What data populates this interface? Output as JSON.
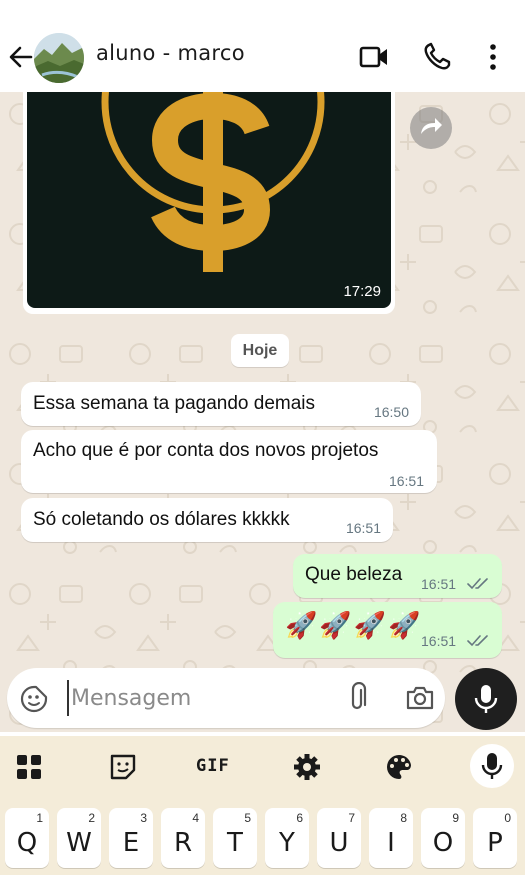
{
  "header": {
    "contact_name": "aluno - marco"
  },
  "chat": {
    "media_time": "17:29",
    "date_chip": "Hoje",
    "messages": [
      {
        "text": "Essa semana ta pagando demais",
        "time": "16:50"
      },
      {
        "text": "Acho que é por conta dos novos projetos",
        "time": "16:51"
      },
      {
        "text": "Só coletando os dólares kkkkk",
        "time": "16:51"
      },
      {
        "text": "Que beleza",
        "time": "16:51"
      },
      {
        "text": "🚀🚀🚀🚀",
        "time": "16:51"
      }
    ]
  },
  "composer": {
    "placeholder": "Mensagem"
  },
  "keyboard": {
    "gif_label": "GIF",
    "keys": [
      {
        "char": "Q",
        "num": "1"
      },
      {
        "char": "W",
        "num": "2"
      },
      {
        "char": "E",
        "num": "3"
      },
      {
        "char": "R",
        "num": "4"
      },
      {
        "char": "T",
        "num": "5"
      },
      {
        "char": "Y",
        "num": "6"
      },
      {
        "char": "U",
        "num": "7"
      },
      {
        "char": "I",
        "num": "8"
      },
      {
        "char": "O",
        "num": "9"
      },
      {
        "char": "P",
        "num": "0"
      }
    ]
  },
  "icons": {
    "back": "arrow-left-icon",
    "video": "video-camera-icon",
    "call": "phone-icon",
    "menu": "more-vertical-icon",
    "forward": "forward-icon",
    "emoji": "sticker-icon",
    "attach": "paperclip-icon",
    "camera": "camera-icon",
    "mic": "mic-icon"
  },
  "colors": {
    "chat_background": "#efe7dd",
    "outgoing_bubble": "#d9fdd3",
    "incoming_bubble": "#ffffff",
    "read_ticks": "#667781",
    "keyboard_background": "#f4ecd9",
    "coin_gold": "#d99f2b"
  }
}
